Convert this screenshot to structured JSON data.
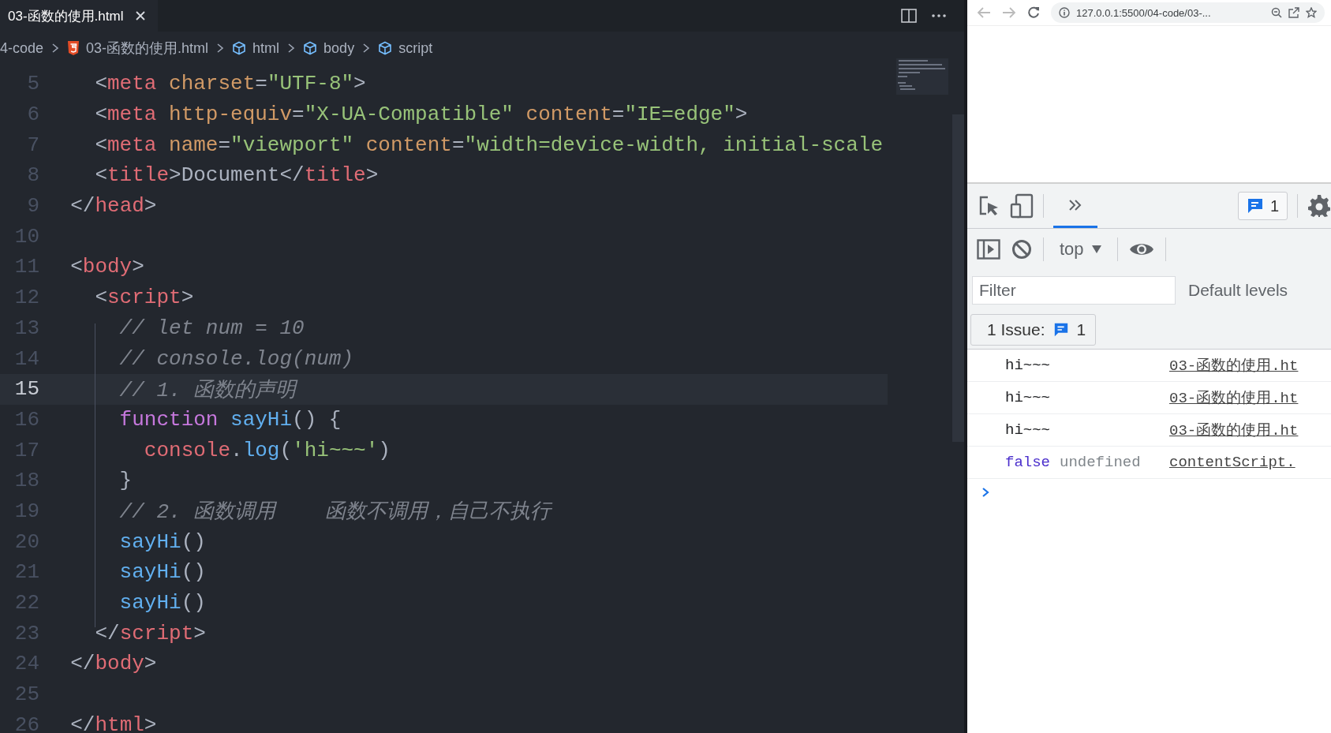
{
  "editor": {
    "tabs": [
      {
        "label": "03-函数的使用.html",
        "selected": true
      }
    ],
    "breadcrumbs": [
      {
        "label": "4-code",
        "kind": "folder"
      },
      {
        "label": "03-函数的使用.html",
        "kind": "html5"
      },
      {
        "label": "html",
        "kind": "element"
      },
      {
        "label": "body",
        "kind": "element"
      },
      {
        "label": "script",
        "kind": "element"
      }
    ],
    "lines": [
      {
        "number": "5",
        "current": false,
        "tokens": [
          {
            "kind": "punct",
            "text": "    <"
          },
          {
            "kind": "tag",
            "text": "meta"
          },
          {
            "kind": "attr",
            "text": " charset"
          },
          {
            "kind": "punct",
            "text": "="
          },
          {
            "kind": "string",
            "text": "\"UTF-8\""
          },
          {
            "kind": "punct",
            "text": ">"
          }
        ]
      },
      {
        "number": "6",
        "current": false,
        "tokens": [
          {
            "kind": "punct",
            "text": "    <"
          },
          {
            "kind": "tag",
            "text": "meta"
          },
          {
            "kind": "attr",
            "text": " http-equiv"
          },
          {
            "kind": "punct",
            "text": "="
          },
          {
            "kind": "string",
            "text": "\"X-UA-Compatible\""
          },
          {
            "kind": "attr",
            "text": " content"
          },
          {
            "kind": "punct",
            "text": "="
          },
          {
            "kind": "string",
            "text": "\"IE=edge\""
          },
          {
            "kind": "punct",
            "text": ">"
          }
        ]
      },
      {
        "number": "7",
        "current": false,
        "tokens": [
          {
            "kind": "punct",
            "text": "    <"
          },
          {
            "kind": "tag",
            "text": "meta"
          },
          {
            "kind": "attr",
            "text": " name"
          },
          {
            "kind": "punct",
            "text": "="
          },
          {
            "kind": "string",
            "text": "\"viewport\""
          },
          {
            "kind": "attr",
            "text": " content"
          },
          {
            "kind": "punct",
            "text": "="
          },
          {
            "kind": "string",
            "text": "\"width=device-width, initial-scale"
          }
        ]
      },
      {
        "number": "8",
        "current": false,
        "tokens": [
          {
            "kind": "punct",
            "text": "    <"
          },
          {
            "kind": "tag",
            "text": "title"
          },
          {
            "kind": "punct",
            "text": ">"
          },
          {
            "kind": "text",
            "text": "Document"
          },
          {
            "kind": "punct",
            "text": "</"
          },
          {
            "kind": "tag",
            "text": "title"
          },
          {
            "kind": "punct",
            "text": ">"
          }
        ]
      },
      {
        "number": "9",
        "current": false,
        "tokens": [
          {
            "kind": "punct",
            "text": "  </"
          },
          {
            "kind": "tag",
            "text": "head"
          },
          {
            "kind": "punct",
            "text": ">"
          }
        ]
      },
      {
        "number": "10",
        "current": false
      },
      {
        "number": "11",
        "current": false,
        "tokens": [
          {
            "kind": "punct",
            "text": "  <"
          },
          {
            "kind": "tag",
            "text": "body"
          },
          {
            "kind": "punct",
            "text": ">"
          }
        ]
      },
      {
        "number": "12",
        "current": false,
        "tokens": [
          {
            "kind": "punct",
            "text": "    <"
          },
          {
            "kind": "tag",
            "text": "script"
          },
          {
            "kind": "punct",
            "text": ">"
          }
        ]
      },
      {
        "number": "13",
        "current": false,
        "tokens": [
          {
            "kind": "comment",
            "text": "      // let num = 10"
          }
        ]
      },
      {
        "number": "14",
        "current": false,
        "tokens": [
          {
            "kind": "comment",
            "text": "      // console.log(num)"
          }
        ]
      },
      {
        "number": "15",
        "current": true,
        "tokens": [
          {
            "kind": "comment",
            "text": "      // 1. 函数的声明"
          }
        ]
      },
      {
        "number": "16",
        "current": false,
        "tokens": [
          {
            "kind": "keyword",
            "text": "      function"
          },
          {
            "kind": "function",
            "text": " sayHi"
          },
          {
            "kind": "punct",
            "text": "() {"
          }
        ]
      },
      {
        "number": "17",
        "current": false,
        "tokens": [
          {
            "kind": "object",
            "text": "        console"
          },
          {
            "kind": "punct",
            "text": "."
          },
          {
            "kind": "function",
            "text": "log"
          },
          {
            "kind": "punct",
            "text": "("
          },
          {
            "kind": "string",
            "text": "'hi~~~'"
          },
          {
            "kind": "punct",
            "text": ")"
          }
        ]
      },
      {
        "number": "18",
        "current": false,
        "tokens": [
          {
            "kind": "punct",
            "text": "      }"
          }
        ]
      },
      {
        "number": "19",
        "current": false,
        "tokens": [
          {
            "kind": "comment",
            "text": "      // 2. 函数调用    函数不调用，自己不执行"
          }
        ]
      },
      {
        "number": "20",
        "current": false,
        "tokens": [
          {
            "kind": "function",
            "text": "      sayHi"
          },
          {
            "kind": "punct",
            "text": "()"
          }
        ]
      },
      {
        "number": "21",
        "current": false,
        "tokens": [
          {
            "kind": "function",
            "text": "      sayHi"
          },
          {
            "kind": "punct",
            "text": "()"
          }
        ]
      },
      {
        "number": "22",
        "current": false,
        "tokens": [
          {
            "kind": "function",
            "text": "      sayHi"
          },
          {
            "kind": "punct",
            "text": "()"
          }
        ]
      },
      {
        "number": "23",
        "current": false,
        "tokens": [
          {
            "kind": "punct",
            "text": "    </"
          },
          {
            "kind": "tag",
            "text": "script"
          },
          {
            "kind": "punct",
            "text": ">"
          }
        ]
      },
      {
        "number": "24",
        "current": false,
        "tokens": [
          {
            "kind": "punct",
            "text": "  </"
          },
          {
            "kind": "tag",
            "text": "body"
          },
          {
            "kind": "punct",
            "text": ">"
          }
        ]
      },
      {
        "number": "25",
        "current": false
      },
      {
        "number": "26",
        "current": false,
        "tokens": [
          {
            "kind": "punct",
            "text": "  </"
          },
          {
            "kind": "tag",
            "text": "html"
          },
          {
            "kind": "punct",
            "text": ">"
          }
        ]
      }
    ]
  },
  "browser": {
    "address": "127.0.0.1:5500/04-code/03-...",
    "devtools": {
      "overflow_tab": {
        "selected": true
      },
      "issues_badge": "1",
      "context": "top",
      "filter": {
        "placeholder": "Filter"
      },
      "levels": "Default levels",
      "issues_button": {
        "label": "1 Issue:",
        "count": "1"
      },
      "messages": [
        {
          "values": [
            {
              "kind": "text",
              "text": "hi~~~"
            }
          ],
          "source": "03-函数的使用.ht"
        },
        {
          "values": [
            {
              "kind": "text",
              "text": "hi~~~"
            }
          ],
          "source": "03-函数的使用.ht"
        },
        {
          "values": [
            {
              "kind": "text",
              "text": "hi~~~"
            }
          ],
          "source": "03-函数的使用.ht"
        },
        {
          "values": [
            {
              "kind": "boolean",
              "text": "false"
            },
            {
              "kind": "undefined",
              "text": "undefined"
            }
          ],
          "source": "contentScript."
        }
      ]
    }
  }
}
